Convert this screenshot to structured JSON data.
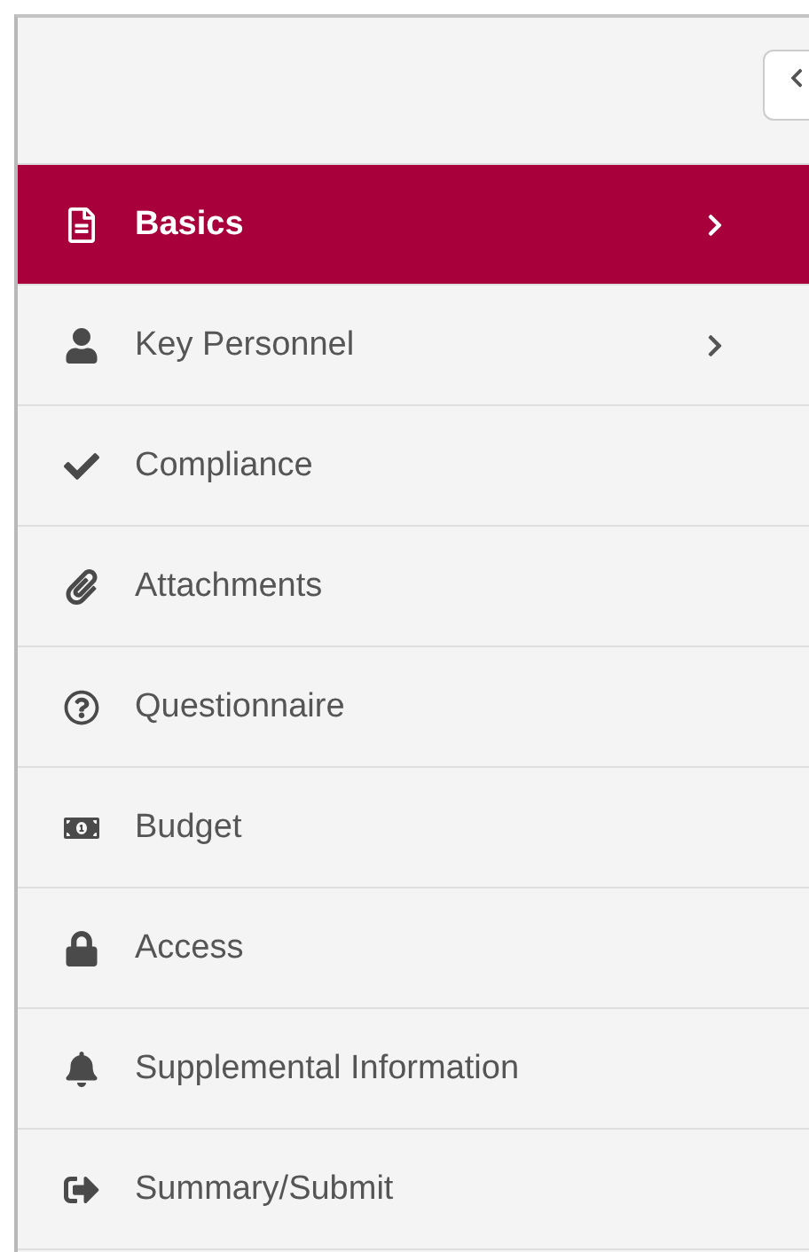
{
  "nav_items": [
    {
      "label": "Basics",
      "selected": true,
      "submenu": true
    },
    {
      "label": "Key Personnel",
      "selected": false,
      "submenu": true
    },
    {
      "label": "Compliance",
      "selected": false,
      "submenu": false
    },
    {
      "label": "Attachments",
      "selected": false,
      "submenu": false
    },
    {
      "label": "Questionnaire",
      "selected": false,
      "submenu": false
    },
    {
      "label": "Budget",
      "selected": false,
      "submenu": false
    },
    {
      "label": "Access",
      "selected": false,
      "submenu": false
    },
    {
      "label": "Supplemental Information",
      "selected": false,
      "submenu": false
    },
    {
      "label": "Summary/Submit",
      "selected": false,
      "submenu": false
    }
  ]
}
